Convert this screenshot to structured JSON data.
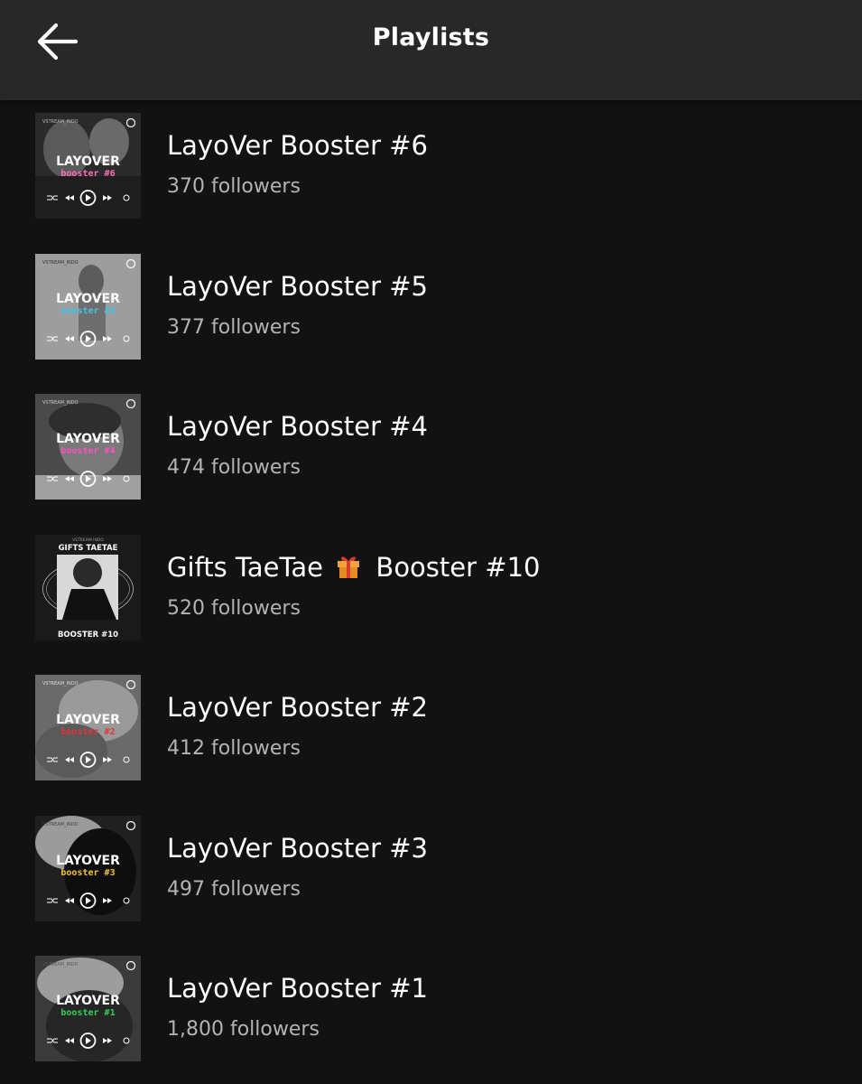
{
  "header": {
    "title": "Playlists",
    "back_icon": "arrow-left-icon"
  },
  "colors": {
    "background": "#121212",
    "header_background": "#282828",
    "subtitle": "#b3b3b3"
  },
  "playlists": [
    {
      "title": "LayoVer Booster #6",
      "followers": "370 followers",
      "cover": {
        "brand": "VSTREAM_INDO",
        "word": "LAYOVER",
        "tag": "booster #6",
        "accent": "#ff6bb4",
        "bg": "#2a2a2a"
      }
    },
    {
      "title": "LayoVer Booster #5",
      "followers": "377 followers",
      "cover": {
        "brand": "VSTREAM_INDO",
        "word": "LAYOVER",
        "tag": "booster #5",
        "accent": "#3fc3e6",
        "bg": "#8a8a8a"
      }
    },
    {
      "title": "LayoVer Booster #4",
      "followers": "474 followers",
      "cover": {
        "brand": "VSTREAM_INDO",
        "word": "LAYOVER",
        "tag": "booster #4",
        "accent": "#ff4fc3",
        "bg": "#4a4a4a"
      }
    },
    {
      "title_pre": "Gifts TaeTae",
      "title_icon": "gift-icon",
      "title_post": "Booster #10",
      "followers": "520 followers",
      "cover": {
        "brand": "VSTREAM INDO",
        "heading": "GIFTS TAETAE",
        "footer": "BOOSTER #10",
        "bg": "#1a1a1a"
      }
    },
    {
      "title": "LayoVer Booster #2",
      "followers": "412 followers",
      "cover": {
        "brand": "VSTREAM_INDO",
        "word": "LAYOVER",
        "tag": "booster #2",
        "accent": "#e8323a",
        "bg": "#6a6a6a"
      }
    },
    {
      "title": "LayoVer Booster #3",
      "followers": "497 followers",
      "cover": {
        "brand": "VSTREAM_INDO",
        "word": "LAYOVER",
        "tag": "booster #3",
        "accent": "#f2c230",
        "bg": "#202020"
      }
    },
    {
      "title": "LayoVer Booster #1",
      "followers": "1,800 followers",
      "cover": {
        "brand": "VSTREAM_INDO",
        "word": "LAYOVER",
        "tag": "booster #1",
        "accent": "#2fd15a",
        "bg": "#3a3a3a"
      }
    }
  ]
}
